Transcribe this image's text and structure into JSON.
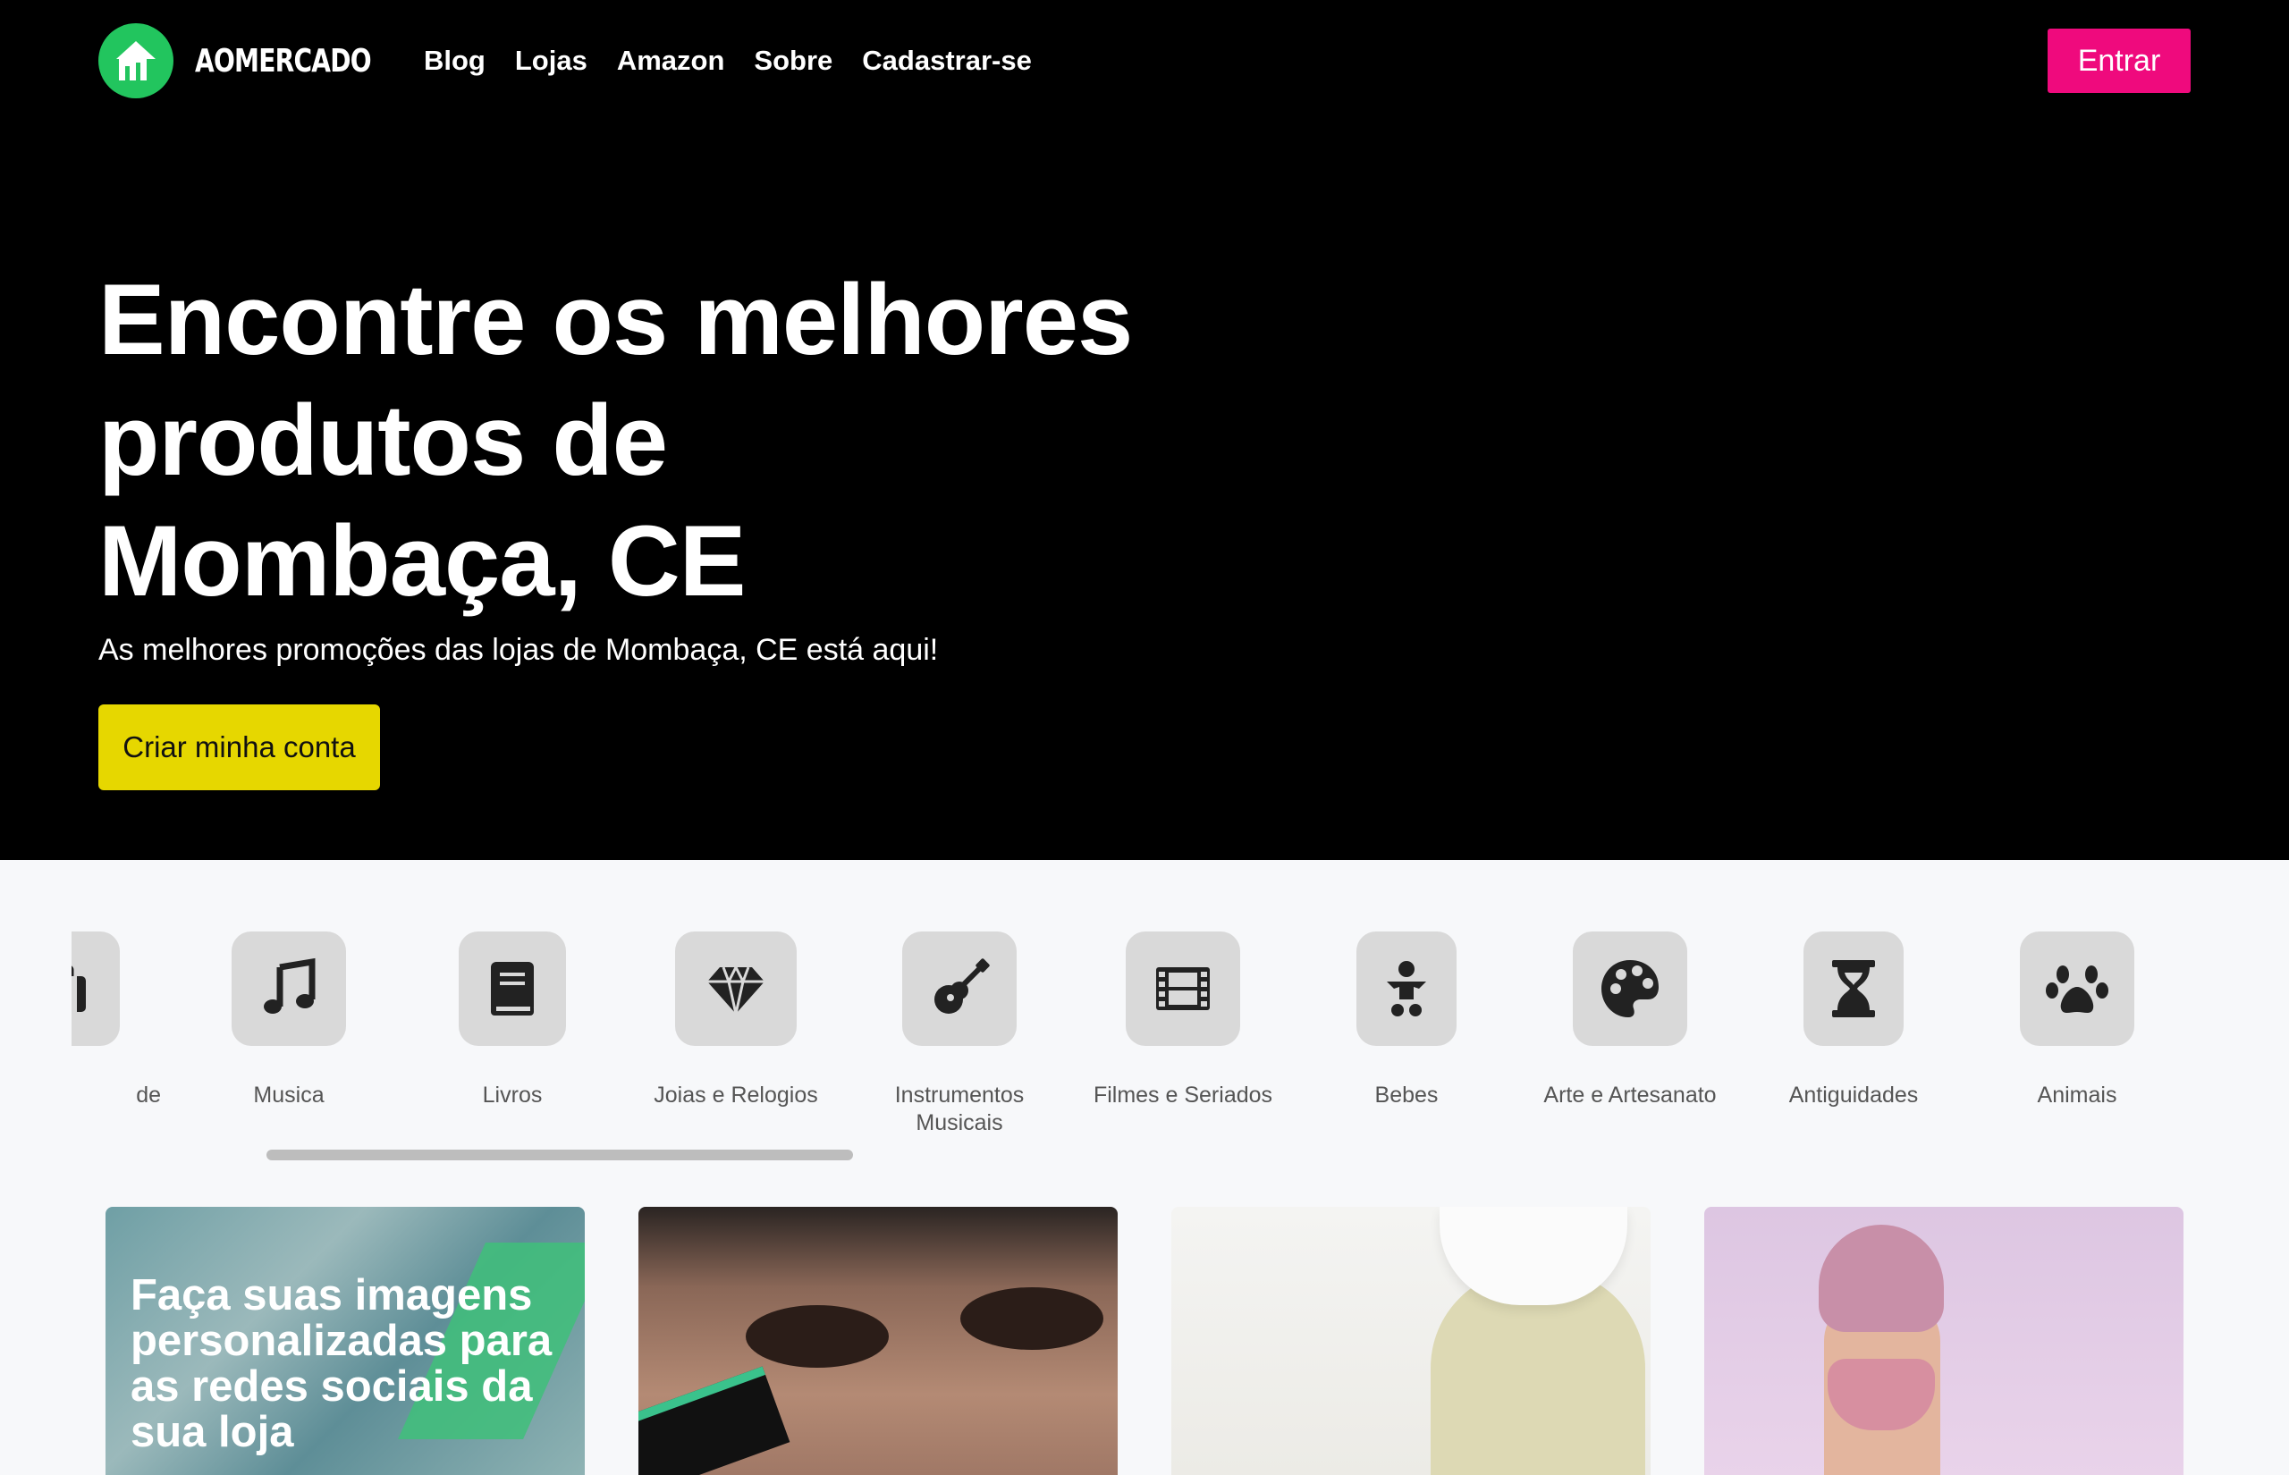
{
  "header": {
    "logo_text": "AOMERCADO",
    "nav": [
      "Blog",
      "Lojas",
      "Amazon",
      "Sobre",
      "Cadastrar-se"
    ],
    "login_label": "Entrar",
    "accent_color": "#ef0a7d",
    "logo_color": "#22c55e"
  },
  "hero": {
    "title_lines": [
      "Encontre os melhores",
      "produtos de",
      "Mombaça, CE"
    ],
    "subtitle": "As melhores promoções das lojas de Mombaça, CE está aqui!",
    "cta_label": "Criar minha conta",
    "cta_color": "#e6d700"
  },
  "categories": [
    {
      "label": "de",
      "icon": "suitcase-icon"
    },
    {
      "label": "Musica",
      "icon": "music-note-icon"
    },
    {
      "label": "Livros",
      "icon": "book-icon"
    },
    {
      "label": "Joias e Relogios",
      "icon": "gem-icon"
    },
    {
      "label": "Instrumentos Musicais",
      "icon": "guitar-icon"
    },
    {
      "label": "Filmes e Seriados",
      "icon": "film-icon"
    },
    {
      "label": "Bebes",
      "icon": "baby-icon"
    },
    {
      "label": "Arte e Artesanato",
      "icon": "palette-icon"
    },
    {
      "label": "Antiguidades",
      "icon": "hourglass-icon"
    },
    {
      "label": "Animais",
      "icon": "paw-icon"
    }
  ],
  "cards": [
    {
      "title": "Faça suas imagens personalizadas para as redes sociais da sua loja"
    },
    {
      "title": ""
    },
    {
      "title": ""
    },
    {
      "title": ""
    }
  ]
}
